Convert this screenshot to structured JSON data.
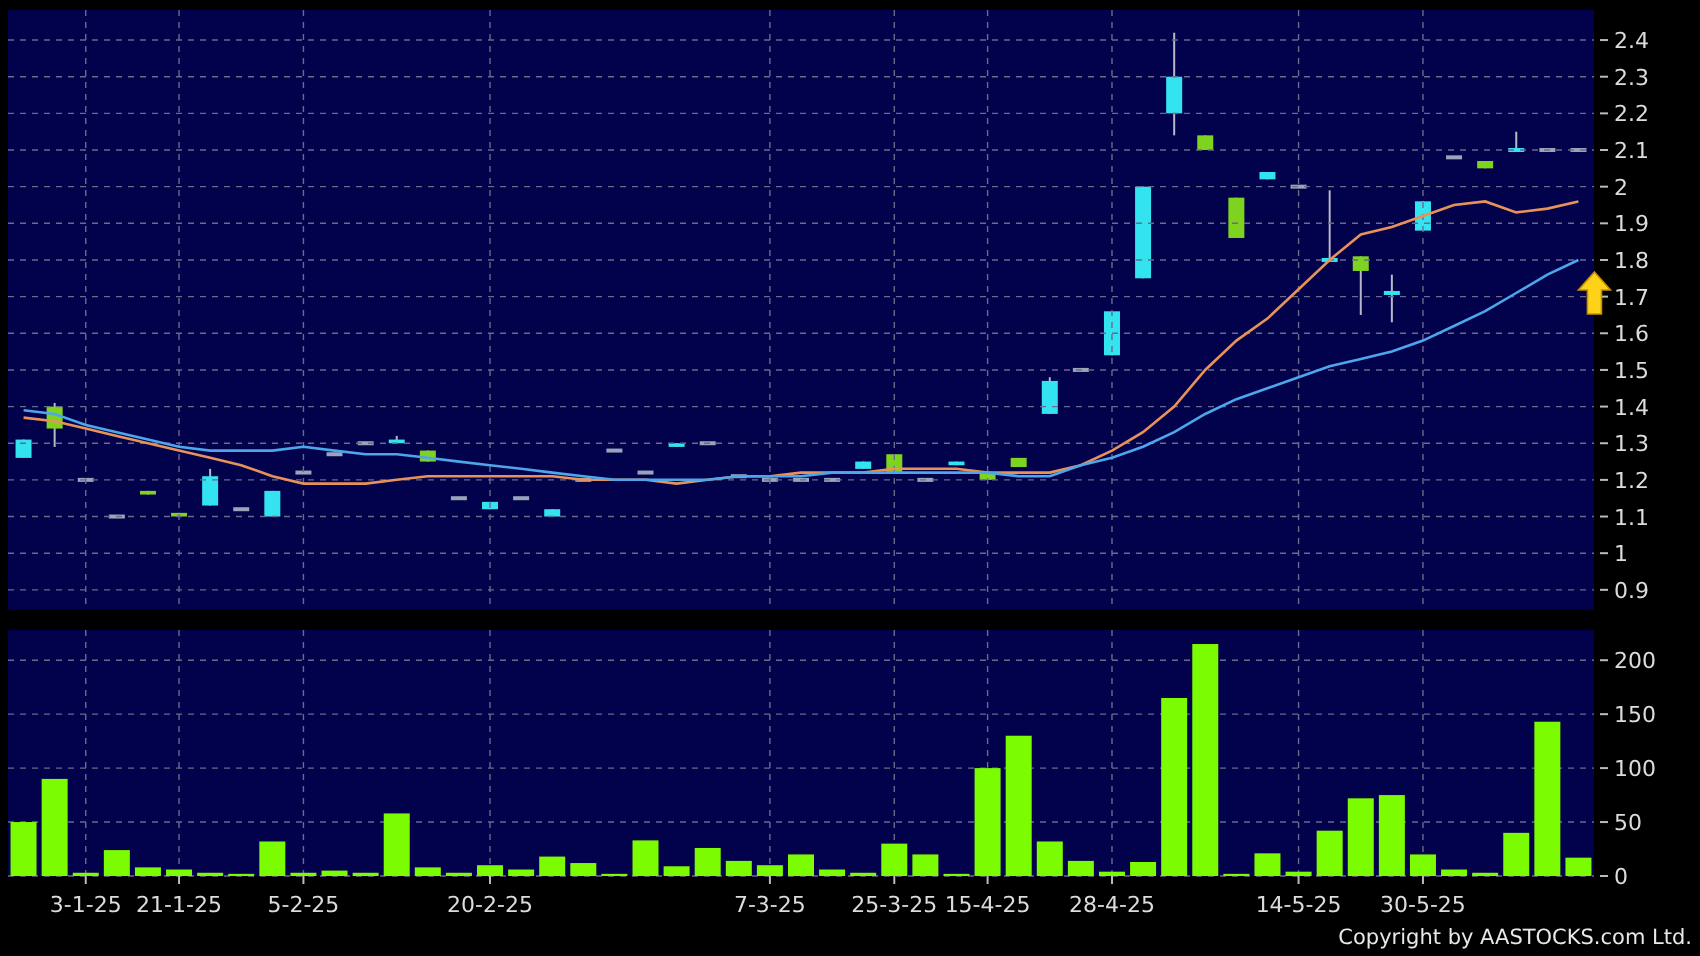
{
  "price_panel": {
    "chart_data": {
      "type": "line",
      "ylim": [
        0.845,
        2.482
      ],
      "grid": true,
      "yticks": [
        0.9,
        1,
        1.1,
        1.2,
        1.3,
        1.4,
        1.5,
        1.6,
        1.7,
        1.8,
        1.9,
        2,
        2.1,
        2.2,
        2.3,
        2.4
      ],
      "series": [
        {
          "color": "#e8925a",
          "values": [
            1.37,
            1.36,
            1.34,
            1.32,
            1.3,
            1.28,
            1.26,
            1.24,
            1.21,
            1.19,
            1.19,
            1.19,
            1.2,
            1.21,
            1.21,
            1.21,
            1.21,
            1.21,
            1.2,
            1.2,
            1.2,
            1.19,
            1.2,
            1.21,
            1.21,
            1.22,
            1.22,
            1.22,
            1.23,
            1.23,
            1.23,
            1.22,
            1.22,
            1.22,
            1.24,
            1.28,
            1.33,
            1.4,
            1.5,
            1.58,
            1.64,
            1.72,
            1.8,
            1.87,
            1.89,
            1.92,
            1.95,
            1.96,
            1.93,
            1.94,
            1.96
          ]
        },
        {
          "color": "#4ea6ea",
          "values": [
            1.39,
            1.38,
            1.35,
            1.33,
            1.31,
            1.29,
            1.28,
            1.28,
            1.28,
            1.29,
            1.28,
            1.27,
            1.27,
            1.26,
            1.25,
            1.24,
            1.23,
            1.22,
            1.21,
            1.2,
            1.2,
            1.2,
            1.2,
            1.21,
            1.21,
            1.21,
            1.22,
            1.22,
            1.22,
            1.22,
            1.22,
            1.22,
            1.21,
            1.21,
            1.24,
            1.26,
            1.29,
            1.33,
            1.38,
            1.42,
            1.45,
            1.48,
            1.51,
            1.53,
            1.55,
            1.58,
            1.62,
            1.66,
            1.71,
            1.76,
            1.8
          ]
        }
      ]
    }
  },
  "volume_panel": {
    "chart_data": {
      "type": "bar",
      "ylim": [
        0,
        228
      ],
      "yticks": [
        0,
        50,
        100,
        150,
        200
      ],
      "grid": true,
      "categories": [
        null,
        null,
        "3-1-25",
        null,
        null,
        "21-1-25",
        null,
        null,
        null,
        "5-2-25",
        null,
        null,
        null,
        null,
        null,
        "20-2-25",
        null,
        null,
        null,
        null,
        null,
        null,
        null,
        null,
        "7-3-25",
        null,
        null,
        null,
        "25-3-25",
        null,
        null,
        "15-4-25",
        null,
        null,
        null,
        "28-4-25",
        null,
        null,
        null,
        null,
        null,
        "14-5-25",
        null,
        null,
        null,
        "30-5-25",
        null,
        null,
        null,
        null,
        null
      ],
      "series": [
        {
          "color": "#7cfc00",
          "values": [
            50,
            90,
            3,
            24,
            8,
            6,
            3,
            2,
            32,
            3,
            5,
            3,
            58,
            8,
            3,
            10,
            6,
            18,
            12,
            2,
            33,
            9,
            26,
            14,
            10,
            20,
            6,
            3,
            30,
            20,
            2,
            100,
            130,
            32,
            14,
            4,
            13,
            165,
            215,
            2,
            21,
            4,
            42,
            72,
            75,
            20,
            6,
            3,
            40,
            143,
            17
          ]
        }
      ]
    }
  },
  "copyright": "Copyright by AASTOCKS.com Ltd."
}
